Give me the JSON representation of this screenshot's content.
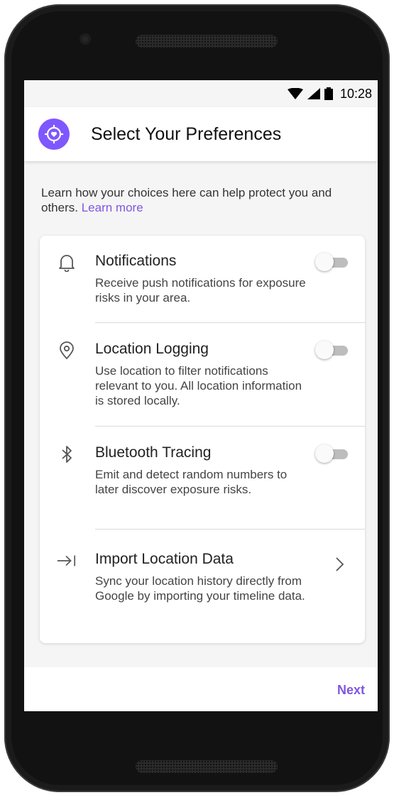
{
  "status_bar": {
    "time": "10:28",
    "icons": [
      "wifi-icon",
      "signal-icon",
      "battery-icon"
    ]
  },
  "app_bar": {
    "title": "Select Your Preferences",
    "logo_icon": "target-heart-icon",
    "accent": "#7e57ff"
  },
  "intro": {
    "text": "Learn how your choices here can help protect you and others.",
    "link": "Learn more",
    "link_color": "#7e57e0"
  },
  "settings": [
    {
      "title": "Notifications",
      "description": "Receive push notifications for exposure risks in your area.",
      "icon": "bell-icon",
      "control": "toggle",
      "enabled": false
    },
    {
      "title": "Location Logging",
      "description": "Use location to filter notifications relevant to you. All location information is stored locally.",
      "icon": "location-pin-icon",
      "control": "toggle",
      "enabled": false
    },
    {
      "title": "Bluetooth Tracing",
      "description": "Emit and detect random numbers to later discover exposure risks.",
      "icon": "bluetooth-icon",
      "control": "toggle",
      "enabled": false
    },
    {
      "title": "Import Location Data",
      "description": "Sync your location history directly from Google by importing your timeline data.",
      "icon": "import-arrow-icon",
      "control": "chevron"
    }
  ],
  "footer": {
    "next_label": "Next"
  }
}
